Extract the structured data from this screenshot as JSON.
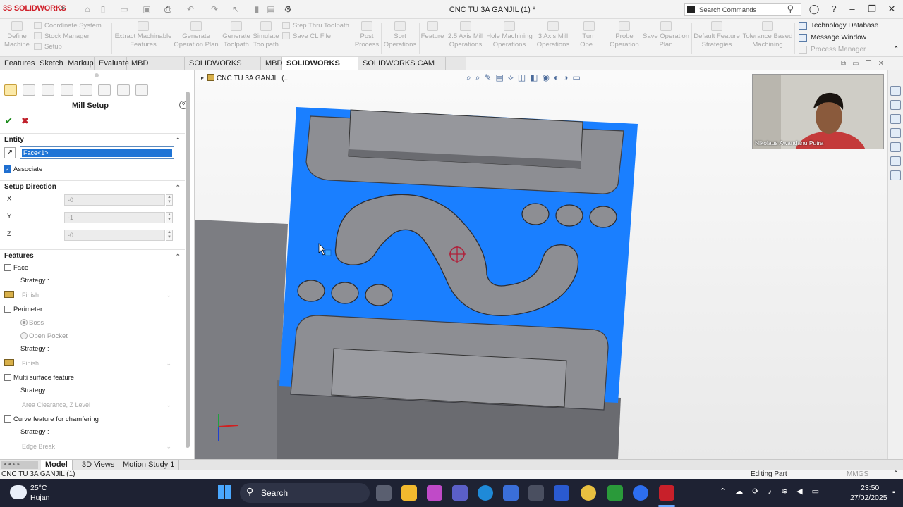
{
  "app": {
    "logo_text": "SOLIDWORKS",
    "document_title": "CNC TU 3A GANJIL (1) *"
  },
  "search": {
    "placeholder": "Search Commands"
  },
  "command_manager": {
    "left_group": [
      {
        "label": "Define\nMachine"
      },
      {
        "label": "Coordinate System"
      },
      {
        "label": "Stock Manager"
      },
      {
        "label": "Setup"
      }
    ],
    "buttons": [
      {
        "label": "Extract Machinable\nFeatures"
      },
      {
        "label": "Generate\nOperation Plan"
      },
      {
        "label": "Generate\nToolpath"
      },
      {
        "label": "Simulate\nToolpath"
      },
      {
        "label": "Step Thru Toolpath"
      },
      {
        "label": "Save CL File"
      },
      {
        "label": "Post\nProcess"
      },
      {
        "label": "Sort\nOperations"
      },
      {
        "label": "Feature"
      },
      {
        "label": "2.5 Axis Mill\nOperations"
      },
      {
        "label": "Hole Machining\nOperations"
      },
      {
        "label": "3 Axis Mill\nOperations"
      },
      {
        "label": "Turn Ope..."
      },
      {
        "label": "Probe\nOperation"
      },
      {
        "label": "Save Operation\nPlan"
      },
      {
        "label": "Default Feature\nStrategies"
      },
      {
        "label": "Tolerance Based\nMachining"
      }
    ],
    "right_group": [
      "Technology Database",
      "Message Window",
      "Process Manager"
    ]
  },
  "tabs": [
    "Features",
    "Sketch",
    "Markup",
    "Evaluate",
    "MBD Dimensions",
    "SOLIDWORKS Add-Ins",
    "MBD",
    "SOLIDWORKS CAM",
    "SOLIDWORKS CAM TBM"
  ],
  "active_tab": "SOLIDWORKS CAM",
  "panel": {
    "title": "Mill Setup",
    "entity_section": "Entity",
    "entity_value": "Face<1>",
    "associate_label": "Associate",
    "setup_direction": "Setup Direction",
    "x_label": "X",
    "x_value": "-0",
    "y_label": "Y",
    "y_value": "-1",
    "z_label": "Z",
    "z_value": "-0",
    "features_section": "Features",
    "face_label": "Face",
    "strategy_label": "Strategy :",
    "face_strategy": "Finish",
    "perimeter_label": "Perimeter",
    "boss_label": "Boss",
    "open_pocket_label": "Open Pocket",
    "perimeter_strategy": "Finish",
    "multi_surface_label": "Multi surface feature",
    "multi_surface_strategy": "Area Clearance, Z Level",
    "curve_label": "Curve feature for chamfering",
    "curve_strategy": "Edge Break"
  },
  "viewport": {
    "tree_item": "CNC TU 3A GANJIL (..."
  },
  "webcam": {
    "name": "Nikolaus Awandanu Putra"
  },
  "bottom_tabs": [
    "Model",
    "3D Views",
    "Motion Study 1"
  ],
  "status": {
    "left": "CNC TU 3A GANJIL (1)",
    "middle": "Editing Part",
    "right": "MMGS"
  },
  "taskbar": {
    "temp": "25°C",
    "weather": "Hujan",
    "search": "Search",
    "time": "23:50",
    "date": "27/02/2025"
  },
  "colors": {
    "selection_blue": "#1a7fff",
    "part_gray": "#8d8e93",
    "accent_red": "#d0202a"
  }
}
